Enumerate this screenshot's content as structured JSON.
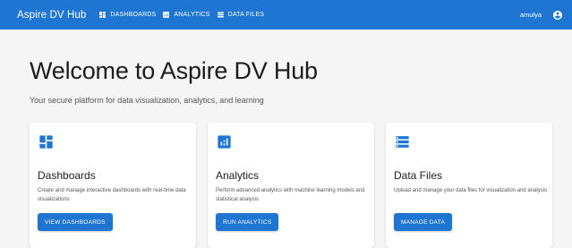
{
  "appbar": {
    "brand": "Aspire DV Hub",
    "nav": [
      {
        "label": "DASHBOARDS",
        "icon": "dashboard-icon"
      },
      {
        "label": "ANALYTICS",
        "icon": "analytics-icon"
      },
      {
        "label": "DATA FILES",
        "icon": "list-icon"
      }
    ],
    "username": "amulya",
    "account_icon": "account-circle-icon"
  },
  "page": {
    "title": "Welcome to Aspire DV Hub",
    "subtitle": "Your secure platform for data visualization, analytics, and learning"
  },
  "cards": [
    {
      "icon": "dashboard-icon",
      "title": "Dashboards",
      "description": "Create and manage interactive dashboards with real-time data visualizations",
      "button": "VIEW DASHBOARDS"
    },
    {
      "icon": "analytics-icon",
      "title": "Analytics",
      "description": "Perform advanced analytics with machine learning models and statistical analysis",
      "button": "RUN ANALYTICS"
    },
    {
      "icon": "list-icon",
      "title": "Data Files",
      "description": "Upload and manage your data files for visualization and analysis",
      "button": "MANAGE DATA"
    }
  ],
  "colors": {
    "primary": "#1e76d2",
    "background": "#f5f5f5",
    "card": "#ffffff"
  }
}
